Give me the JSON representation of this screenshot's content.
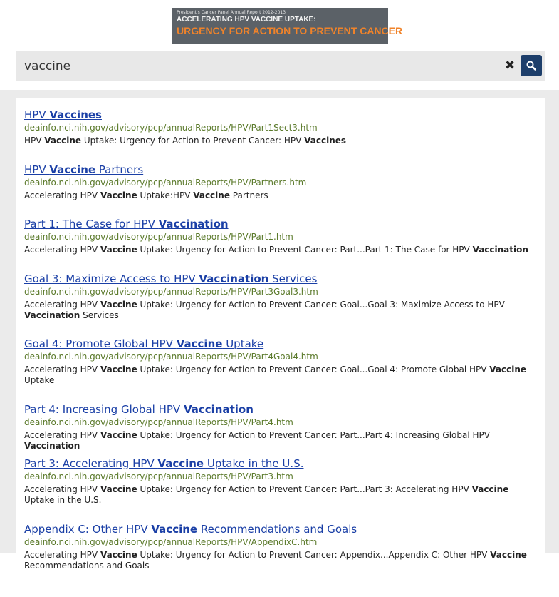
{
  "banner": {
    "kicker": "President's Cancer Panel Annual Report 2012-2013",
    "title_line1": "ACCELERATING HPV VACCINE UPTAKE:",
    "title_line2": "URGENCY FOR ACTION TO PREVENT CANCER"
  },
  "search": {
    "value": "vaccine",
    "clear_icon": "close-icon",
    "search_icon": "search-icon"
  },
  "colors": {
    "link": "#1a3fa6",
    "url": "#5b7a2b",
    "search_button": "#1e3f6b",
    "banner_accent": "#f0832a"
  },
  "results": [
    {
      "title": [
        "HPV ",
        "Vaccines",
        ""
      ],
      "url": "deainfo.nci.nih.gov/advisory/pcp/annualReports/HPV/Part1Sect3.htm",
      "snippet": [
        "HPV ",
        "Vaccine",
        " Uptake: Urgency for Action to Prevent Cancer: HPV ",
        "Vaccines",
        ""
      ]
    },
    {
      "title": [
        "HPV ",
        "Vaccine",
        " Partners"
      ],
      "url": "deainfo.nci.nih.gov/advisory/pcp/annualReports/HPV/Partners.htm",
      "snippet": [
        "Accelerating HPV ",
        "Vaccine",
        " Uptake:HPV ",
        "Vaccine",
        " Partners"
      ]
    },
    {
      "title": [
        "Part 1: The Case for HPV ",
        "Vaccination",
        ""
      ],
      "url": "deainfo.nci.nih.gov/advisory/pcp/annualReports/HPV/Part1.htm",
      "snippet": [
        "Accelerating HPV ",
        "Vaccine",
        " Uptake: Urgency for Action to Prevent Cancer: Part...Part 1: The Case for HPV ",
        "Vaccination",
        ""
      ]
    },
    {
      "title": [
        "Goal 3: Maximize Access to HPV ",
        "Vaccination",
        " Services"
      ],
      "url": "deainfo.nci.nih.gov/advisory/pcp/annualReports/HPV/Part3Goal3.htm",
      "snippet": [
        "Accelerating HPV ",
        "Vaccine",
        " Uptake: Urgency for Action to Prevent Cancer: Goal...Goal 3: Maximize Access to HPV ",
        "Vaccination",
        " Services"
      ]
    },
    {
      "title": [
        "Goal 4: Promote Global HPV ",
        "Vaccine",
        " Uptake"
      ],
      "url": "deainfo.nci.nih.gov/advisory/pcp/annualReports/HPV/Part4Goal4.htm",
      "snippet": [
        "Accelerating HPV ",
        "Vaccine",
        " Uptake: Urgency for Action to Prevent Cancer: Goal...Goal 4: Promote Global HPV ",
        "Vaccine",
        " Uptake"
      ]
    },
    {
      "title": [
        "Part 4: Increasing Global HPV ",
        "Vaccination",
        ""
      ],
      "url": "deainfo.nci.nih.gov/advisory/pcp/annualReports/HPV/Part4.htm",
      "snippet": [
        "Accelerating HPV ",
        "Vaccine",
        " Uptake: Urgency for Action to Prevent Cancer: Part...Part 4: Increasing Global HPV ",
        "Vaccination",
        ""
      ]
    },
    {
      "title": [
        "Part 3: Accelerating HPV ",
        "Vaccine",
        " Uptake in the U.S."
      ],
      "url": "deainfo.nci.nih.gov/advisory/pcp/annualReports/HPV/Part3.htm",
      "snippet": [
        "Accelerating HPV ",
        "Vaccine",
        " Uptake: Urgency for Action to Prevent Cancer: Part...Part 3: Accelerating HPV ",
        "Vaccine",
        " Uptake in the U.S."
      ]
    },
    {
      "title": [
        "Appendix C: Other HPV ",
        "Vaccine",
        " Recommendations and Goals"
      ],
      "url": "deainfo.nci.nih.gov/advisory/pcp/annualReports/HPV/AppendixC.htm",
      "snippet": [
        "Accelerating HPV ",
        "Vaccine",
        " Uptake: Urgency for Action to Prevent Cancer: Appendix...Appendix C: Other HPV ",
        "Vaccine",
        " Recommendations and Goals"
      ]
    }
  ]
}
